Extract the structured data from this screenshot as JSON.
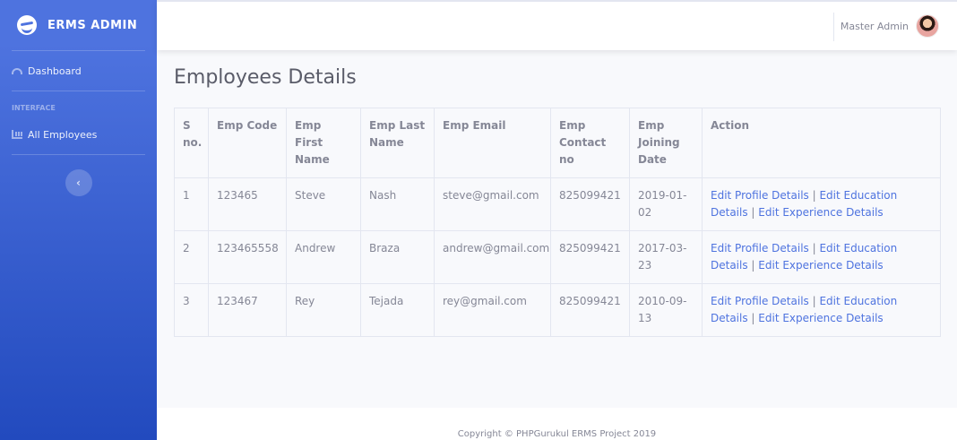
{
  "brand": {
    "name": "ERMS ADMIN"
  },
  "sidebar": {
    "dashboard": "Dashboard",
    "heading": "INTERFACE",
    "all_employees": "All Employees",
    "toggle_glyph": "‹"
  },
  "topbar": {
    "user_name": "Master Admin"
  },
  "page": {
    "title": "Employees Details"
  },
  "table": {
    "headers": [
      "S no.",
      "Emp Code",
      "Emp First Name",
      "Emp Last Name",
      "Emp Email",
      "Emp Contact no",
      "Emp Joining Date",
      "Action"
    ],
    "rows": [
      {
        "sno": "1",
        "code": "123465",
        "first": "Steve",
        "last": "Nash",
        "email": "steve@gmail.com",
        "contact": "825099421",
        "date": "2019-01-02"
      },
      {
        "sno": "2",
        "code": "123465558",
        "first": "Andrew",
        "last": "Braza",
        "email": "andrew@gmail.com",
        "contact": "825099421",
        "date": "2017-03-23"
      },
      {
        "sno": "3",
        "code": "123467",
        "first": "Rey",
        "last": "Tejada",
        "email": "rey@gmail.com",
        "contact": "825099421",
        "date": "2010-09-13"
      }
    ],
    "actions": {
      "profile": "Edit Profile Details",
      "education": "Edit Education Details",
      "experience": "Edit Experience Details",
      "separator": " | "
    }
  },
  "footer": {
    "text": "Copyright © PHPGurukul ERMS Project 2019"
  },
  "colors": {
    "primary": "#4e73df",
    "sidebar_bottom": "#224abe",
    "text": "#858796",
    "title": "#5a5c69"
  }
}
